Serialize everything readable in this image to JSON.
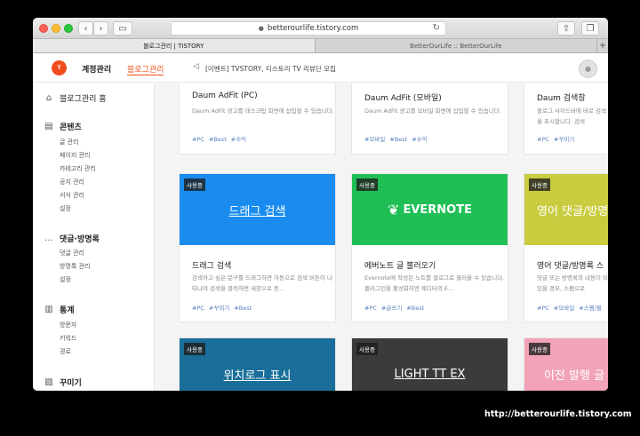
{
  "browser": {
    "url": "betterourlife.tistory.com",
    "tabs": [
      "블로그관리 | TISTORY",
      "BetterOurLife :: BetterOurLife"
    ]
  },
  "header": {
    "logo_text": "T",
    "nav": [
      "계정관리",
      "블로그관리"
    ],
    "notice": "[이벤트] TVSTORY, 티스토리 TV 리뷰단 모집"
  },
  "sidebar": {
    "home": "블로그관리 홈",
    "sections": [
      {
        "title": "콘텐츠",
        "icon": "document-icon",
        "items": [
          "글 관리",
          "페이지 관리",
          "카테고리 관리",
          "공지 관리",
          "서식 관리",
          "설정"
        ]
      },
      {
        "title": "댓글·방명록",
        "icon": "comment-icon",
        "items": [
          "댓글 관리",
          "방명록 관리",
          "설정"
        ]
      },
      {
        "title": "통계",
        "icon": "bar-chart-icon",
        "items": [
          "방문자",
          "키워드",
          "경로"
        ]
      },
      {
        "title": "꾸미기",
        "icon": "paint-icon",
        "items": []
      }
    ]
  },
  "plugins": {
    "badge": "사용중",
    "row1": [
      {
        "title": "Daum AdFit (PC)",
        "desc": "Daum AdFit 광고를 데스크탑 화면에 삽입할 수 있습니다.",
        "tags": [
          "#PC",
          "#Best",
          "#수익"
        ]
      },
      {
        "title": "Daum AdFit (모바일)",
        "desc": "Daum AdFit 광고를 모바일 화면에 삽입할 수 있습니다.",
        "tags": [
          "#모바일",
          "#Best",
          "#수익"
        ]
      },
      {
        "title": "Daum 검색창",
        "desc": "블로그 사이드바에 바로 검색을 표시합니다. 검색",
        "tags": [
          "#PC",
          "#꾸미기"
        ]
      }
    ],
    "row2": [
      {
        "thumb": "드래그 검색",
        "title": "드래그 검색",
        "desc": "검색하고 싶은 문구를 드래그하면 자동으로 검색 버튼이 나타나며 검색을 클릭하면 새창으로 등...",
        "tags": [
          "#PC",
          "#꾸미기",
          "#Best"
        ],
        "color": "#1a8cf0"
      },
      {
        "thumb": "EVERNOTE",
        "title": "에버노트 글 불러오기",
        "desc": "Evernote에 작성된 노트를 블로그로 불러올 수 있습니다. 플러그인을 활성화하면 에디터의 E...",
        "tags": [
          "#PC",
          "#글쓰기",
          "#Best"
        ],
        "color": "#1fbf55"
      },
      {
        "thumb": "영어 댓글/방명",
        "title": "영어 댓글/방명록 스",
        "desc": "댓글 또는 방명록의 내용이 되어 있을 경우, 스팸으로",
        "tags": [
          "#PC",
          "#모바일",
          "#스팸/불"
        ],
        "color": "#c9cc3e"
      }
    ],
    "row3": [
      {
        "thumb": "위치로그 표시",
        "color": "#1a6f9a"
      },
      {
        "thumb": "LIGHT TT EX",
        "color": "#3d3b3a"
      },
      {
        "thumb": "이전 발행 글",
        "color": "#f2a3b8"
      }
    ]
  },
  "watermark": "http://betterourlife.tistory.com"
}
